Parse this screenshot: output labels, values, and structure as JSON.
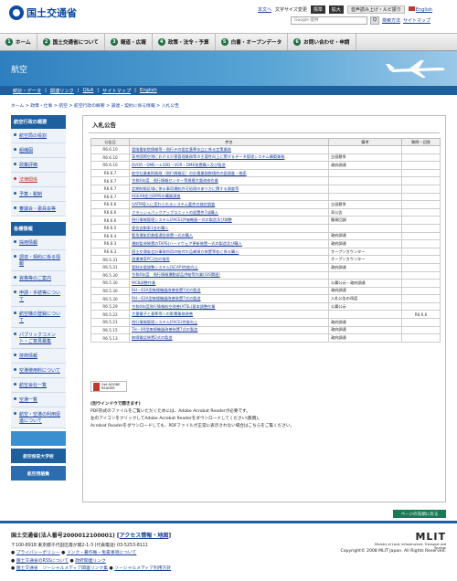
{
  "header": {
    "logo_text": "国土交通省",
    "util_links": [
      "本文へ",
      "文字サイズ変更",
      "標準",
      "拡大",
      "音声読み上げ・ルビ振り",
      "English"
    ],
    "search_placeholder": "Google 提供",
    "search_button": "Q",
    "search_links": [
      "検索方法",
      "サイトマップ"
    ]
  },
  "gnav": [
    {
      "num": "1",
      "label": "ホーム"
    },
    {
      "num": "2",
      "label": "国土交通省について"
    },
    {
      "num": "3",
      "label": "報道・広報"
    },
    {
      "num": "4",
      "label": "政策・法令・予算"
    },
    {
      "num": "5",
      "label": "白書・オープンデータ"
    },
    {
      "num": "6",
      "label": "お問い合わせ・申請"
    }
  ],
  "hero": {
    "title": "航空"
  },
  "subnav": [
    "統計・データ",
    "関連リンク",
    "Q&A",
    "サイトマップ",
    "English"
  ],
  "breadcrumb": "ホーム > 政策・仕事 > 航空 > 航空行政の概要 > 調達・契約に係る情報 > 入札公告",
  "sidebar": {
    "sec1_title": "航空行政の概要",
    "sec1_items": [
      "航空局の役割",
      "組織図",
      "政策評価",
      "法律関係",
      "予算・税制",
      "審議会・委員会等"
    ],
    "sec2_title": "各種情報",
    "sec2_items": [
      "採用情報",
      "調達・契約に係る情報",
      "資格等のご案内",
      "申請・手続等について",
      "航空機の登録について",
      "パブリックコメント・ご意見募集",
      "技術情報",
      "空港使用料について",
      "航空会社一覧",
      "空港一覧",
      "航空・空港の利用促進について"
    ],
    "banners": [
      "",
      "航空保安大学校",
      "航空用語集"
    ]
  },
  "main": {
    "title": "入札公告",
    "col_date": "公告日",
    "col_title": "件名",
    "col_note": "備考",
    "col_remark": "質問・回答",
    "rows": [
      {
        "d": "R6.6.10",
        "t": "冒険番航院情報等・飛行テの設定基準存立に係る定策業務",
        "n": "",
        "r": ""
      },
      {
        "d": "R6.6.10",
        "t": "東京国際空港における災害管理業務等の主要性向上に関するデータ管理システム構築業務",
        "n": "企画競争",
        "r": ""
      },
      {
        "d": "R6.6.10",
        "t": "DVOR・DME一±1BD－VOR・DME装置購入及び製造",
        "n": "政府調達",
        "r": ""
      },
      {
        "d": "R6.6.7",
        "t": "航空社業者財務政（飛行情報区）の計量業務数値的の設調査・検索",
        "n": "",
        "r": ""
      },
      {
        "d": "R6.6.7",
        "t": "令和6年度　飛行情報センター等規模大量改修作業",
        "n": "",
        "r": ""
      },
      {
        "d": "R6.6.7",
        "t": "定期制限区域に係る事用運航許可処理のあり方に関する調査等",
        "n": "",
        "r": ""
      },
      {
        "d": "R6.6.7",
        "t": "AGEAN定点DMSの購買調査",
        "n": "",
        "r": ""
      },
      {
        "d": "R6.6.6",
        "t": "UATM導入に変わられるシステム要件の検討調査",
        "n": "企画競争",
        "r": ""
      },
      {
        "d": "R6.6.6",
        "t": "フラッシュパックアップユニットの設置件7ほ購入",
        "n": "両公告",
        "r": ""
      },
      {
        "d": "R6.6.6",
        "t": "飛行情報管理システム(FACE)評価機器一式の製造及び調整",
        "n": "簡易回調",
        "r": ""
      },
      {
        "d": "R6.6.5",
        "t": "東信自動車1台の購入",
        "n": "",
        "r": ""
      },
      {
        "d": "R6.6.4",
        "t": "緊急運航用救援通信装置一式の購入",
        "n": "政府調達",
        "r": ""
      },
      {
        "d": "R6.6.3",
        "t": "運航監視装置のTAPS(ハードウェア更新装置一式の製造及び購入",
        "n": "政府調達",
        "r": ""
      },
      {
        "d": "R6.6.3",
        "t": "国土交通省会計事務所用の給付の品補資方装置等各に係る購入",
        "n": "オープンカウンター",
        "r": ""
      },
      {
        "d": "R6.5.31",
        "t": "国運携帯PC2台の借用",
        "n": "オープンカウンター",
        "r": ""
      },
      {
        "d": "R6.5.31",
        "t": "管制支援調整システム(SCAP)性能向上",
        "n": "政府調達",
        "r": ""
      },
      {
        "d": "R6.5.30",
        "t": "令和6年度　飛行情報運動部品供給等作業(GIS関連)",
        "n": "",
        "r": ""
      },
      {
        "d": "R6.5.30",
        "t": "MCB調整作業",
        "n": "公募公示・政府調達",
        "r": ""
      },
      {
        "d": "R6.5.30",
        "t": "RH－63A型無線機器改善装置7式の製造",
        "n": "政府調達",
        "r": ""
      },
      {
        "d": "R6.5.30",
        "t": "RH－63A型無線機器改善装置7式の製造",
        "n": "入札公告の再度",
        "r": ""
      },
      {
        "d": "R6.5.29",
        "t": "令和6年度飛行情報航空改善(ATSL)基本調整作業",
        "n": "公募公示",
        "r": ""
      },
      {
        "d": "R6.5.22",
        "t": "大量電子と基準等への影響業務改善",
        "n": "",
        "r": "R6.6.6"
      },
      {
        "d": "R6.5.21",
        "t": "飛行情報管理システム(FACE)性能向上",
        "n": "政府調達",
        "r": ""
      },
      {
        "d": "R6.5.15",
        "t": "TH－09型無線機器改善装置7式の製造",
        "n": "政府調達",
        "r": ""
      },
      {
        "d": "R6.5.13",
        "t": "無線電話装置2式の製造",
        "n": "政府調達",
        "r": ""
      }
    ],
    "acrobat_label": "Get ADOBE READER",
    "note_head": "(別ウインドウで開きます)",
    "notes": [
      "PDF形式のファイルをご覧いただくためには、Adobe Acrobat Readerが必要です。",
      "左のアイコンをクリックしてAdobe Acrobat Readerをダウンロードしてください(無償)。",
      "Acrobat Readerをダウンロードしても、PDFファイルが正常に表示されない場合はこちらをご覧ください。"
    ]
  },
  "back_to_top": "ページの先頭に戻る",
  "footer": {
    "name": "国土交通省(法人番号2000012100001)",
    "access": "アクセス情報・地図",
    "address": "〒100-8918 東京都千代田区霞が関2-1-3 (代表電話) 03-5253-8111",
    "links": [
      [
        "プライバシーポリシー",
        "リンク・著作権・免責事項について"
      ],
      [
        "国土交通省のRSSについて",
        "政府関連リンク"
      ],
      [
        "国土交通省　ソーシャルメディア関連リンク集",
        "ソーシャルメディア利用方針"
      ]
    ],
    "mlit": "MLIT",
    "mlit_sub": "Ministry of Land, Infrastructure, Transport and Tourism",
    "copyright": "Copyright© 2008 MLIT Japan. All Rights Reserved."
  }
}
